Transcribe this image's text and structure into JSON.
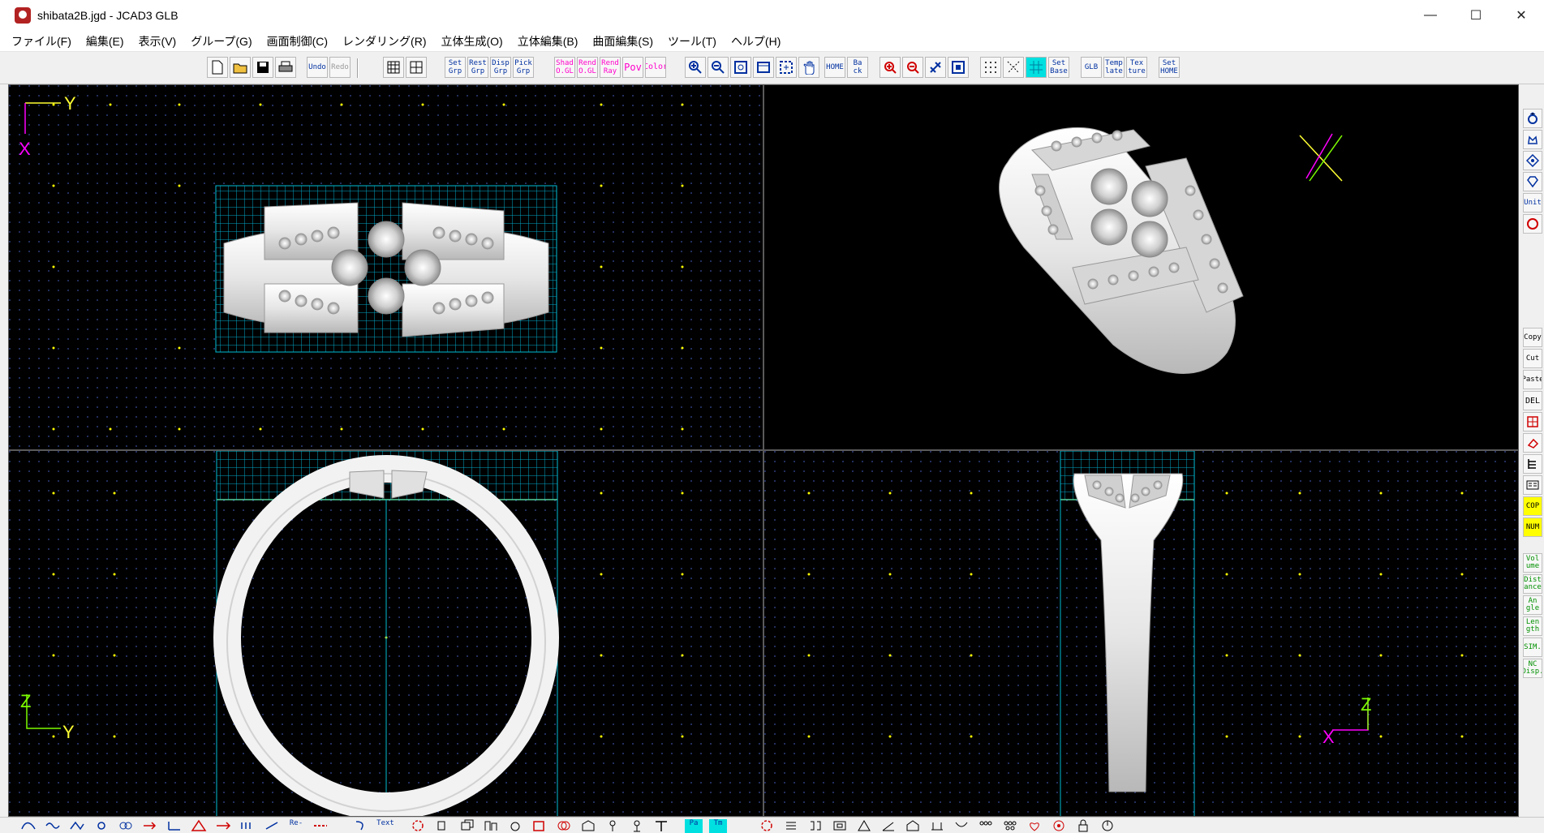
{
  "window": {
    "title": "shibata2B.jgd - JCAD3 GLB",
    "minimize": "—",
    "maximize": "☐",
    "close": "✕"
  },
  "menu": [
    "ファイル(F)",
    "編集(E)",
    "表示(V)",
    "グループ(G)",
    "画面制御(C)",
    "レンダリング(R)",
    "立体生成(O)",
    "立体編集(B)",
    "曲面編集(S)",
    "ツール(T)",
    "ヘルプ(H)"
  ],
  "toolbar": {
    "undo": "Undo",
    "redo": "Redo",
    "set_grp": "Set Grp",
    "reset_grp": "Rest Grp",
    "disp_grp": "Disp Grp",
    "pick_grp": "Pick Grp",
    "shad_ogl": "Shad O.GL",
    "rend_ogl": "Rend O.GL",
    "rend_ray": "Rend Ray",
    "pov": "Pov",
    "color": "Color",
    "home": "HOME",
    "back": "Ba ck",
    "set_base": "Set Base",
    "glb": "GLB",
    "template": "Temp late",
    "texture": "Tex ture",
    "set_home": "Set HOME"
  },
  "viewports": {
    "top": {
      "axis_h": "Y",
      "axis_v": "X"
    },
    "front": {
      "axis_h": "Y",
      "axis_v": "Z"
    },
    "side": {
      "axis_h": "X",
      "axis_v": "Z"
    }
  },
  "right_palette": {
    "unit": "Unit",
    "copy": "Copy",
    "cut": "Cut",
    "paste": "Paste",
    "del": "DEL",
    "cop": "COP",
    "num": "NUM",
    "volume": "Vol ume",
    "distance": "Dist ance",
    "angle": "An gle",
    "length": "Len gth",
    "sim": "SIM.",
    "nc_disp": "NC Disp."
  },
  "bottom_bar": {
    "re": "Re-",
    "text": "Text",
    "pa": "Pa",
    "tm": "Tm"
  },
  "colors": {
    "grid_fill": "#00bcd4",
    "dot_yellow": "#ffff00",
    "axis_yellow": "#ffff33",
    "axis_green": "#7cfc00",
    "axis_magenta": "#ff00ff",
    "ring_white": "#f2f2f2"
  }
}
